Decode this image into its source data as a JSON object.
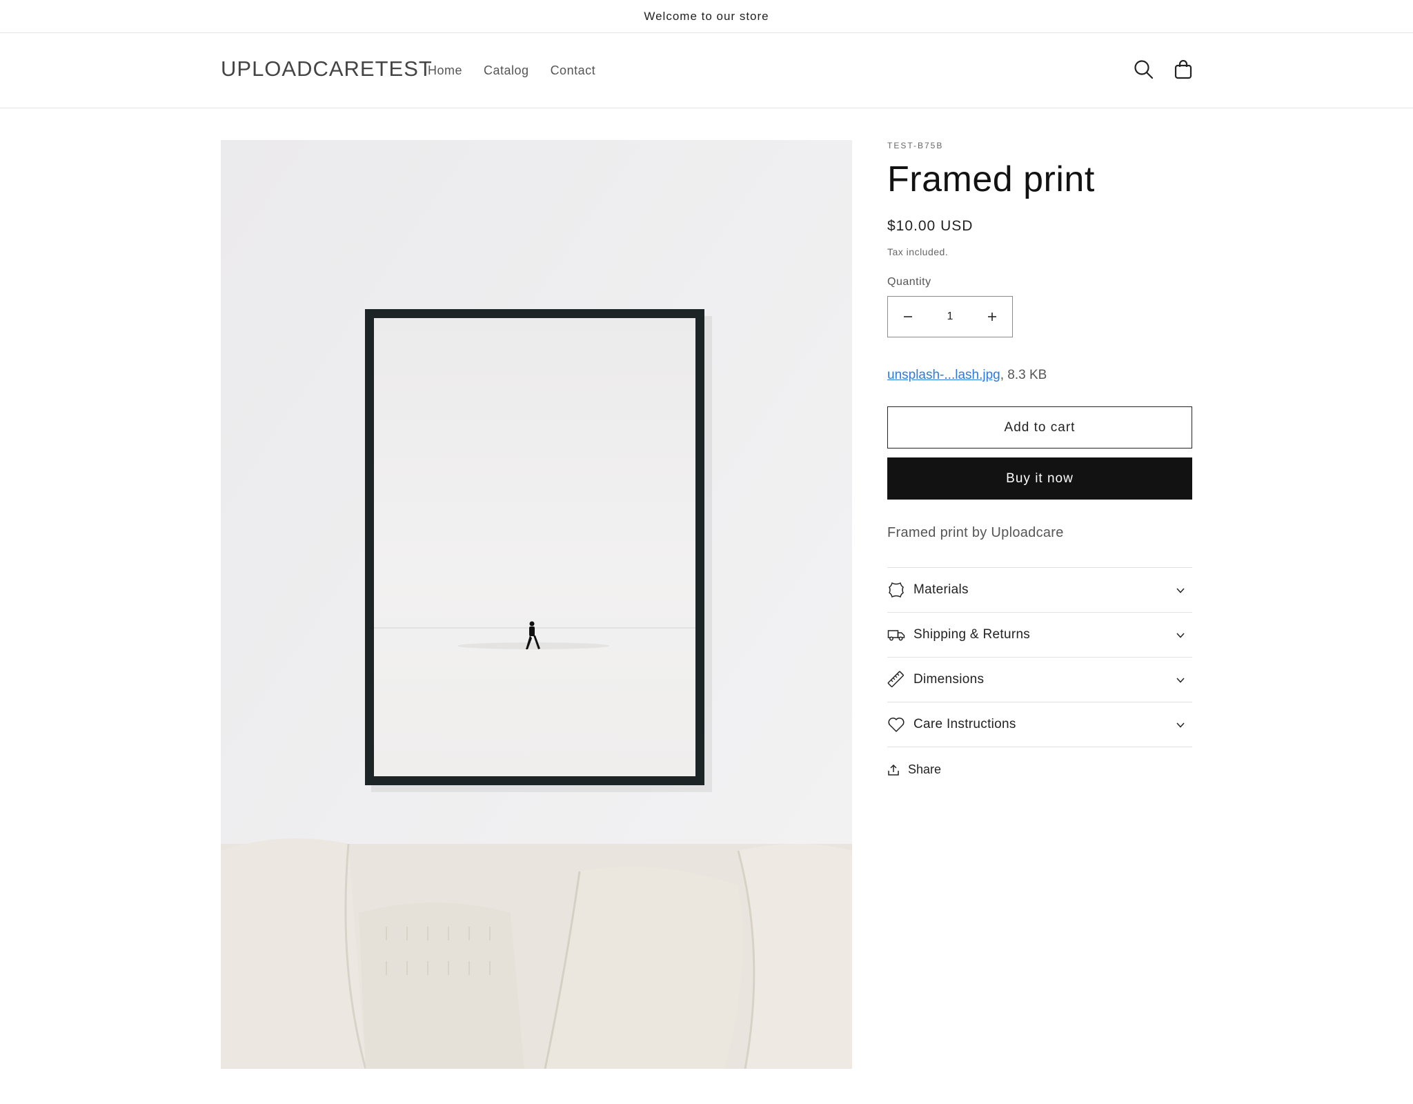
{
  "announcement": {
    "text": "Welcome to our store"
  },
  "header": {
    "logo": "UPLOADCARETEST",
    "nav": [
      "Home",
      "Catalog",
      "Contact"
    ],
    "search_icon": "search-icon",
    "cart_icon": "cart-icon"
  },
  "product": {
    "vendor": "TEST-B75B",
    "title": "Framed print",
    "price": "$10.00 USD",
    "tax_note": "Tax included.",
    "quantity_label": "Quantity",
    "quantity_value": "1",
    "file_link": "unsplash-...lash.jpg",
    "file_size": ", 8.3 KB",
    "add_to_cart": "Add to cart",
    "buy_now": "Buy it now",
    "description": "Framed print by Uploadcare",
    "accordion": [
      {
        "label": "Materials",
        "icon": "leather-icon"
      },
      {
        "label": "Shipping & Returns",
        "icon": "truck-icon"
      },
      {
        "label": "Dimensions",
        "icon": "ruler-icon"
      },
      {
        "label": "Care Instructions",
        "icon": "heart-icon"
      }
    ],
    "share": "Share"
  },
  "colors": {
    "link": "#2a7ae2",
    "button_dark": "#121212",
    "border": "#e2e2e2"
  }
}
